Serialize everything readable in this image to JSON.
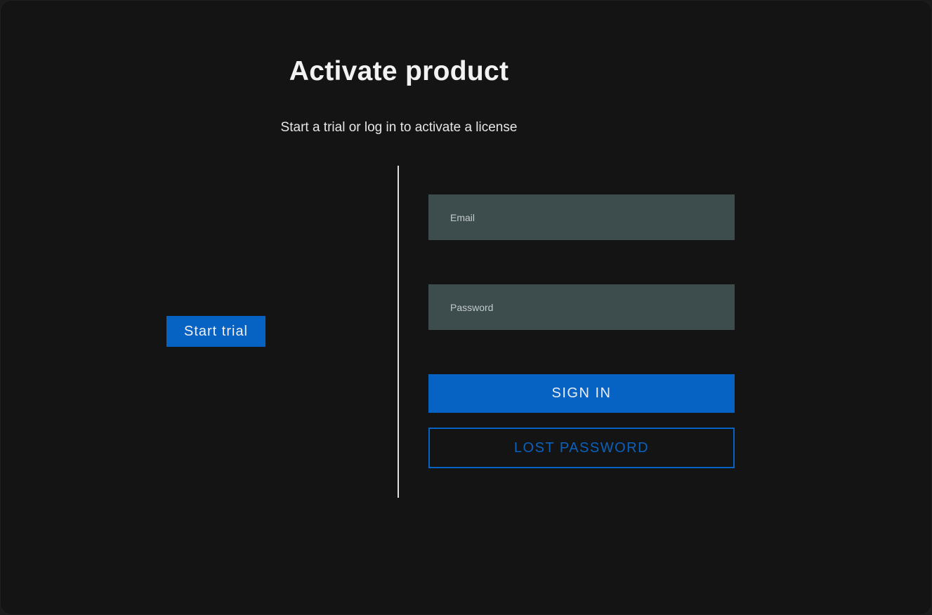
{
  "title": "Activate product",
  "subtitle": "Start a trial or log in to activate a license",
  "trial": {
    "button_label": "Start trial"
  },
  "login": {
    "email_placeholder": "Email",
    "password_placeholder": "Password",
    "sign_in_label": "SIGN IN",
    "lost_password_label": "LOST PASSWORD"
  },
  "colors": {
    "background": "#141414",
    "accent": "#0662c3",
    "field_background": "#3d4d4d",
    "text": "#f2f2f2"
  }
}
